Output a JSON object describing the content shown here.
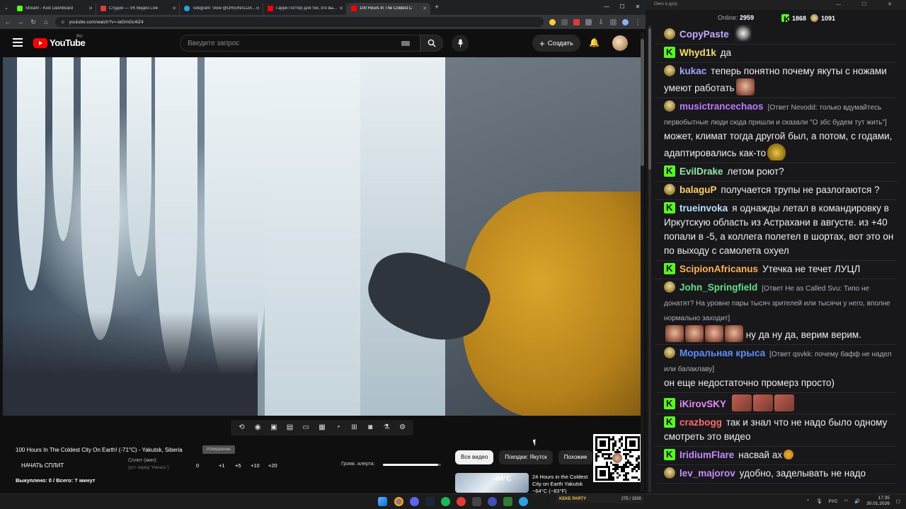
{
  "browser": {
    "tabs": [
      {
        "title": "Stream - Kick Dashboard",
        "color": "#53fc18"
      },
      {
        "title": "Студия — VK Видео Live",
        "color": "#e53935"
      },
      {
        "title": "Telegram: View @ORGINALDA...",
        "color": "#2aa3df"
      },
      {
        "title": "Гарри Поттер для тех, кто вы...",
        "color": "#ff0000"
      },
      {
        "title": "100 Hours In The Coldest C",
        "color": "#ff0000",
        "active": true
      }
    ],
    "new_tab": "+",
    "url": "youtube.com/watch?v=-laGmGc4iZ4"
  },
  "youtube": {
    "logo": "YouTube",
    "region": "RU",
    "search_placeholder": "Введите запрос",
    "create_label": "Создать",
    "video_title": "100 Hours In The Coldest City On Earth! (-71°C) - Yakutsk, Siberia",
    "badge": "Измерение",
    "chips": [
      "Все видео",
      "Поездки: Якутск",
      "Похожие"
    ],
    "recommendation": {
      "temp": "-64°C",
      "title": "24 Hours in the Coldest City on Earth Yakutsk −64°C (−83°F)"
    }
  },
  "split_panel": {
    "start_label": "НАЧАТЬ СПЛИТ",
    "split_label": "Сплит (мин):",
    "split_hint": "(уст. перед \"Начать\")",
    "options": [
      "0",
      "+1",
      "+5",
      "+10",
      "+20"
    ],
    "bought": "Выкуплено: 0 / Всего: ? минут",
    "alert_label": "Громк. алерта:",
    "alert_level": 0.95
  },
  "chat": {
    "window_title": "Окно в духу",
    "online_label": "Online:",
    "online_value": "2959",
    "kick_count": "1868",
    "vk_count": "1091",
    "messages": [
      {
        "platform": "tg",
        "user": "CopyPaste",
        "color": "#c9a9ff",
        "text": "",
        "emotes": [
          "cp"
        ]
      },
      {
        "platform": "kick",
        "user": "Whyd1k",
        "color": "#f6e05e",
        "text": "да"
      },
      {
        "platform": "tg",
        "user": "kukac",
        "color": "#9ea6ff",
        "text": "теперь понятно почему якуты с ножами умеют работать",
        "emotes": [
          "face"
        ]
      },
      {
        "platform": "tg",
        "user": "musictrancechaos",
        "color": "#bd7bff",
        "reply": "[Ответ Nevodd: только вдумайтесь первобытные люди сюда пришли и сказали \"О збс будем тут жить\"]",
        "text": "может, климат тогда другой был, а потом, с годами, адаптировались как-то",
        "emotes": [
          "bowl"
        ]
      },
      {
        "platform": "kick",
        "user": "EvilDrake",
        "color": "#8fe8a8",
        "text": "летом роют?"
      },
      {
        "platform": "tg",
        "user": "balaguP",
        "color": "#ffd15c",
        "text": "получается трупы не разлогаются ?"
      },
      {
        "platform": "kick",
        "user": "trueinvoka",
        "color": "#b5e3ff",
        "text": "я однажды летал в командировку в Иркутскую область из Астрахани в августе. из +40 попали в -5, а коллега полетел в шортах, вот это он по выходу с самолета охуел"
      },
      {
        "platform": "kick",
        "user": "ScipionAfricanus",
        "color": "#ffb347",
        "text": "Утечка не течет ЛУЦЛ"
      },
      {
        "platform": "tg",
        "user": "John_Springfield",
        "color": "#5fe08a",
        "reply": "[Ответ He as Called Svu: Типо не донатят? На уровне пары тысяч зрителей или тысячи у него, вполне нормально заходит]",
        "text": "ну да ну да, верим верим.",
        "emotes": [
          "face",
          "face",
          "face",
          "face"
        ]
      },
      {
        "platform": "tg",
        "user": "Моральная крыса",
        "color": "#5c8eff",
        "reply": "[Ответ qsvkk: почему бафф не надел или балаклаву]",
        "text": "он еще недостаточно промерз просто)"
      },
      {
        "platform": "kick",
        "user": "iKirovSKY",
        "color": "#e78bff",
        "text": "",
        "emotes": [
          "wide",
          "wide",
          "wide"
        ]
      },
      {
        "platform": "kick",
        "user": "crazbogg",
        "color": "#ff6b6b",
        "text": "так и знал что не надо было одному смотреть это видео"
      },
      {
        "platform": "kick",
        "user": "IridiumFlare",
        "color": "#c68bff",
        "text": "насвай ах",
        "emotes": [
          "hand"
        ]
      },
      {
        "platform": "tg",
        "user": "lev_majorov",
        "color": "#c68bff",
        "text": "удобно, заделывать не надо"
      }
    ]
  },
  "taskbar": {
    "kick_mini": {
      "logo": "KEKE PARTY",
      "value": "275 / 1500"
    },
    "lang": "РУС",
    "time": "17:35",
    "date": "30.01.2026"
  }
}
